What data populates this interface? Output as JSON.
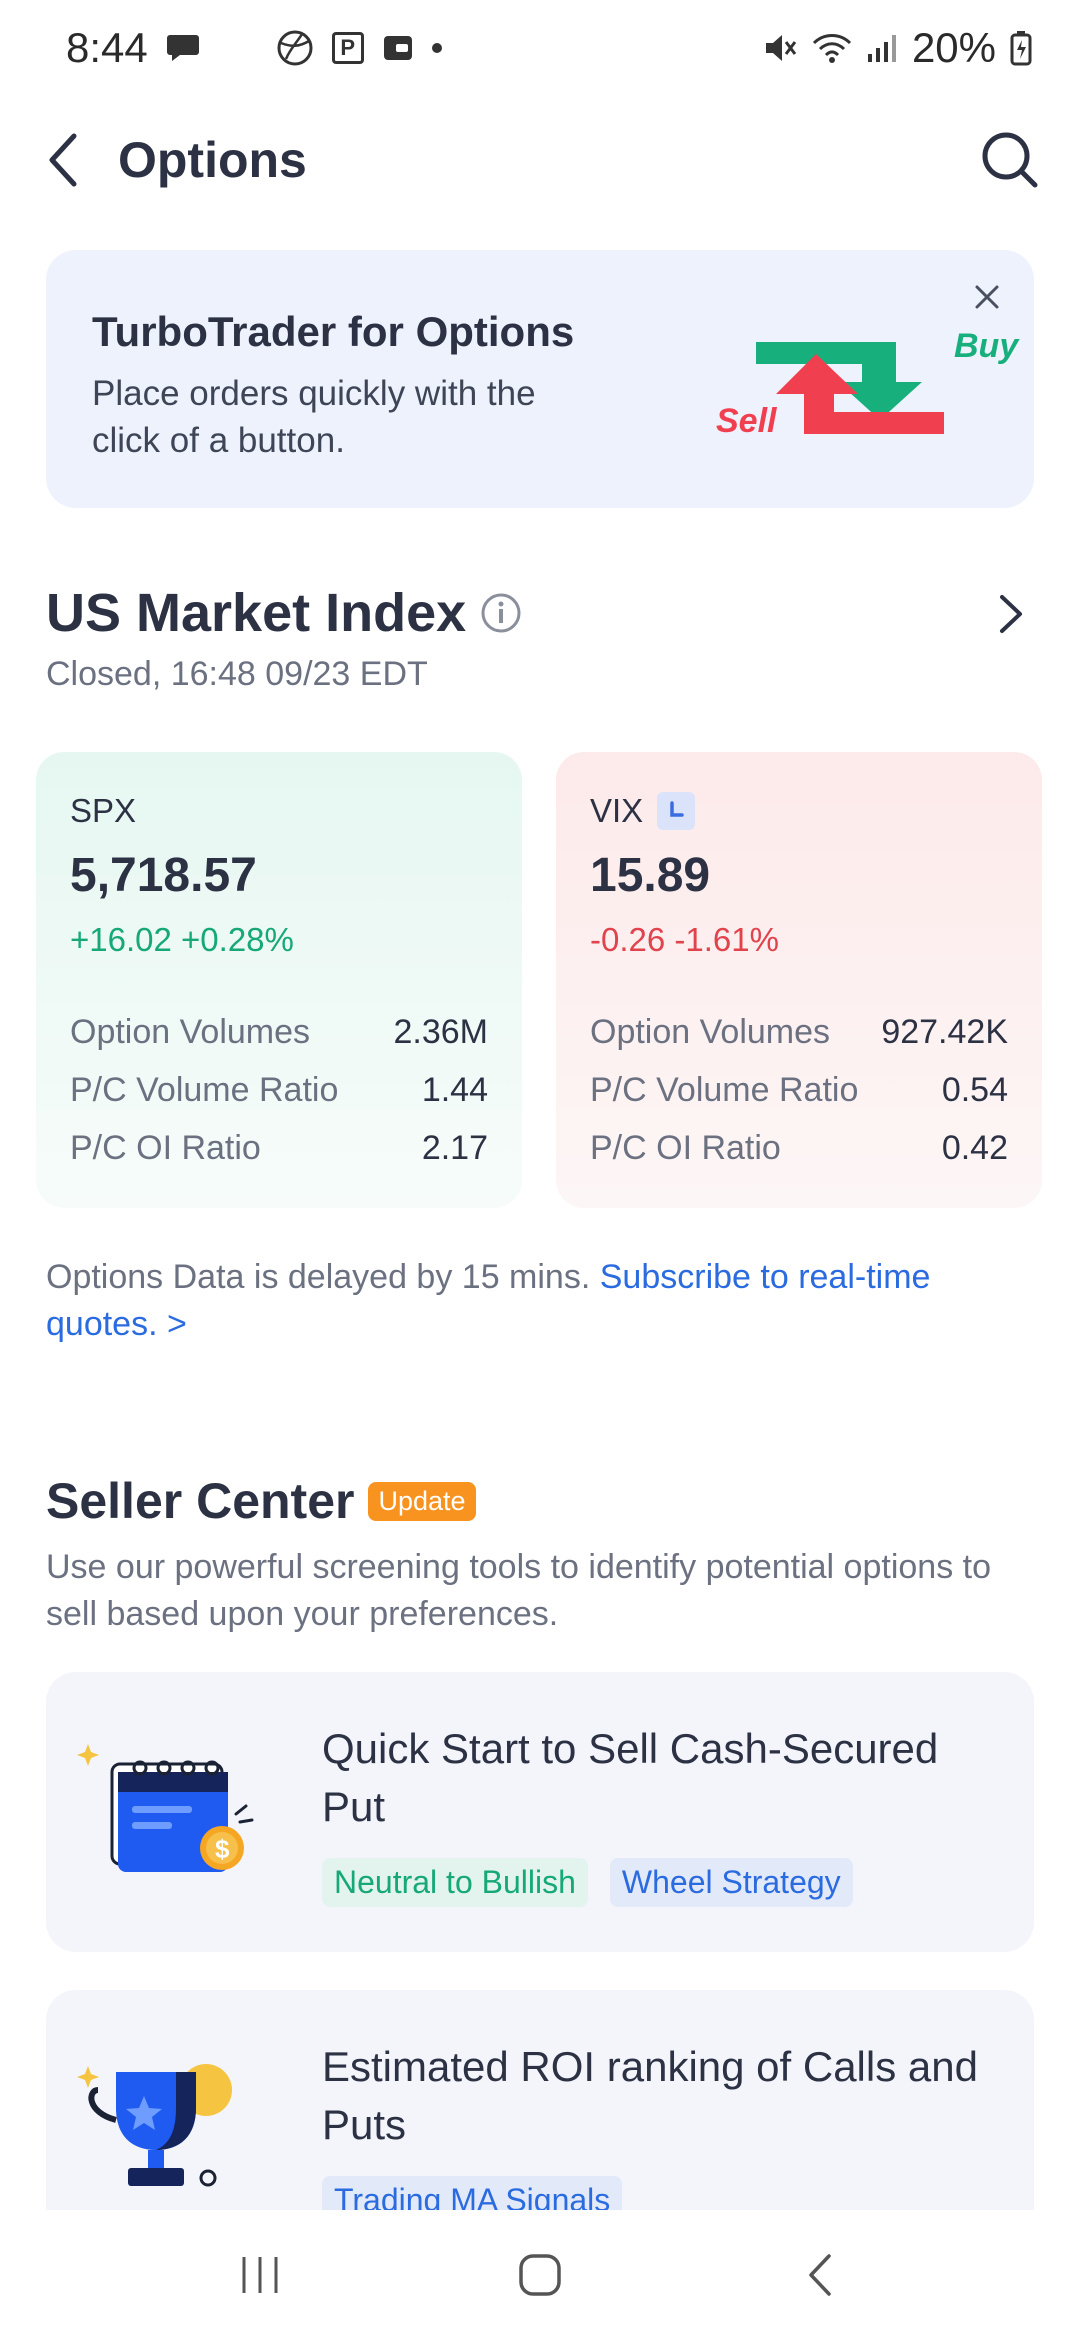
{
  "status_bar": {
    "time": "8:44",
    "battery": "20%"
  },
  "header": {
    "title": "Options"
  },
  "banner": {
    "title": "TurboTrader for Options",
    "subtitle": "Place orders quickly with the click of a button.",
    "art_buy_label": "Buy",
    "art_sell_label": "Sell"
  },
  "market": {
    "title": "US Market Index",
    "status": "Closed, 16:48 09/23 EDT",
    "cards": [
      {
        "name": "SPX",
        "price": "5,718.57",
        "change": "+16.02 +0.28%",
        "rows": [
          {
            "label": "Option Volumes",
            "value": "2.36M"
          },
          {
            "label": "P/C Volume Ratio",
            "value": "1.44"
          },
          {
            "label": "P/C OI Ratio",
            "value": "2.17"
          }
        ]
      },
      {
        "name": "VIX",
        "price": "15.89",
        "change": "-0.26 -1.61%",
        "rows": [
          {
            "label": "Option Volumes",
            "value": "927.42K"
          },
          {
            "label": "P/C Volume Ratio",
            "value": "0.54"
          },
          {
            "label": "P/C OI Ratio",
            "value": "0.42"
          }
        ]
      }
    ],
    "delay_note": "Options Data is delayed by 15 mins.",
    "subscribe_link": "Subscribe to real-time quotes. >"
  },
  "seller_center": {
    "title": "Seller Center",
    "badge": "Update",
    "subtitle": "Use our powerful screening tools to identify potential options to sell based upon your preferences.",
    "cards": [
      {
        "title": "Quick Start to Sell Cash-Secured Put",
        "tags": [
          "Neutral to Bullish",
          "Wheel Strategy"
        ],
        "icon": "calendar-coin-icon"
      },
      {
        "title": "Estimated ROI ranking of Calls and Puts",
        "tags": [
          "Trading MA Signals"
        ],
        "icon": "trophy-icon"
      }
    ]
  },
  "colors": {
    "up": "#17a878",
    "down": "#e0434b",
    "link": "#2b6be0",
    "badge": "#f7931e"
  }
}
